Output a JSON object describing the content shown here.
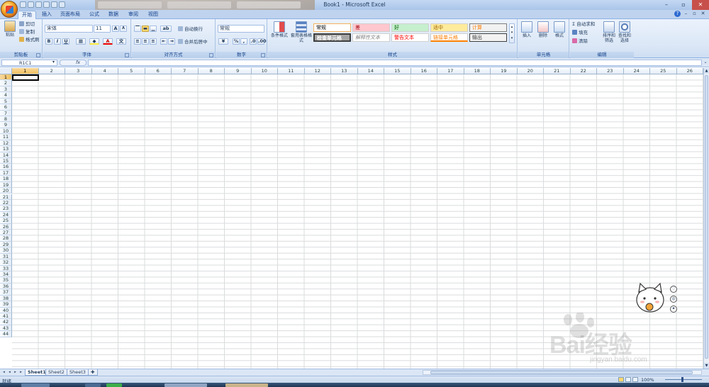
{
  "window": {
    "title": "Book1 - Microsoft Excel"
  },
  "tabs": [
    "开始",
    "插入",
    "页面布局",
    "公式",
    "数据",
    "审阅",
    "视图"
  ],
  "clipboard": {
    "paste": "粘贴",
    "cut": "剪切",
    "copy": "复制",
    "format_painter": "格式刷",
    "label": "剪贴板"
  },
  "font": {
    "name": "宋体",
    "size": "11",
    "label": "字体",
    "bold": "B",
    "italic": "I",
    "underline": "U",
    "grow": "A",
    "shrink": "A"
  },
  "alignment": {
    "wrap": "自动换行",
    "merge": "合并后居中",
    "label": "对齐方式"
  },
  "number": {
    "format": "常规",
    "percent": "%",
    "comma": ",",
    "label": "数字"
  },
  "styles": {
    "conditional": "条件格式",
    "table_format": "套用表格格式",
    "label": "样式",
    "cells": [
      "常规",
      "差",
      "好",
      "适中",
      "计算",
      "检查单元格",
      "解释性文本",
      "警告文本",
      "链接单元格",
      "输出"
    ]
  },
  "cells_group": {
    "insert": "插入",
    "delete": "删除",
    "format": "格式",
    "label": "单元格"
  },
  "editing": {
    "autosum": "自动求和",
    "fill": "填充",
    "clear": "清除",
    "sort": "排序和筛选",
    "find": "查找和选择",
    "label": "编辑"
  },
  "formula_bar": {
    "name_box": "R1C1",
    "fx": "fx",
    "content": ""
  },
  "columns": [
    "1",
    "2",
    "3",
    "4",
    "5",
    "6",
    "7",
    "8",
    "9",
    "10",
    "11",
    "12",
    "13",
    "14",
    "15",
    "16",
    "17",
    "18",
    "19",
    "20",
    "21",
    "22",
    "23",
    "24",
    "25",
    "26"
  ],
  "rows": [
    "1",
    "2",
    "3",
    "4",
    "5",
    "6",
    "7",
    "8",
    "9",
    "10",
    "11",
    "12",
    "13",
    "14",
    "15",
    "16",
    "17",
    "18",
    "19",
    "20",
    "21",
    "22",
    "23",
    "24",
    "25",
    "26",
    "27",
    "28",
    "29",
    "30",
    "31",
    "32",
    "33",
    "34",
    "35",
    "36",
    "37",
    "38",
    "39",
    "40",
    "41",
    "42",
    "43",
    "44"
  ],
  "sheets": [
    "Sheet1",
    "Sheet2",
    "Sheet3"
  ],
  "status": {
    "text": "就绪",
    "zoom": "100%"
  },
  "watermark": {
    "brand": "Bai经验",
    "site": "jingyan.baidu.com"
  },
  "colors": {
    "accent": "#15428b",
    "ribbon": "#dbe7f6",
    "selected_header": "#f1c15f"
  }
}
